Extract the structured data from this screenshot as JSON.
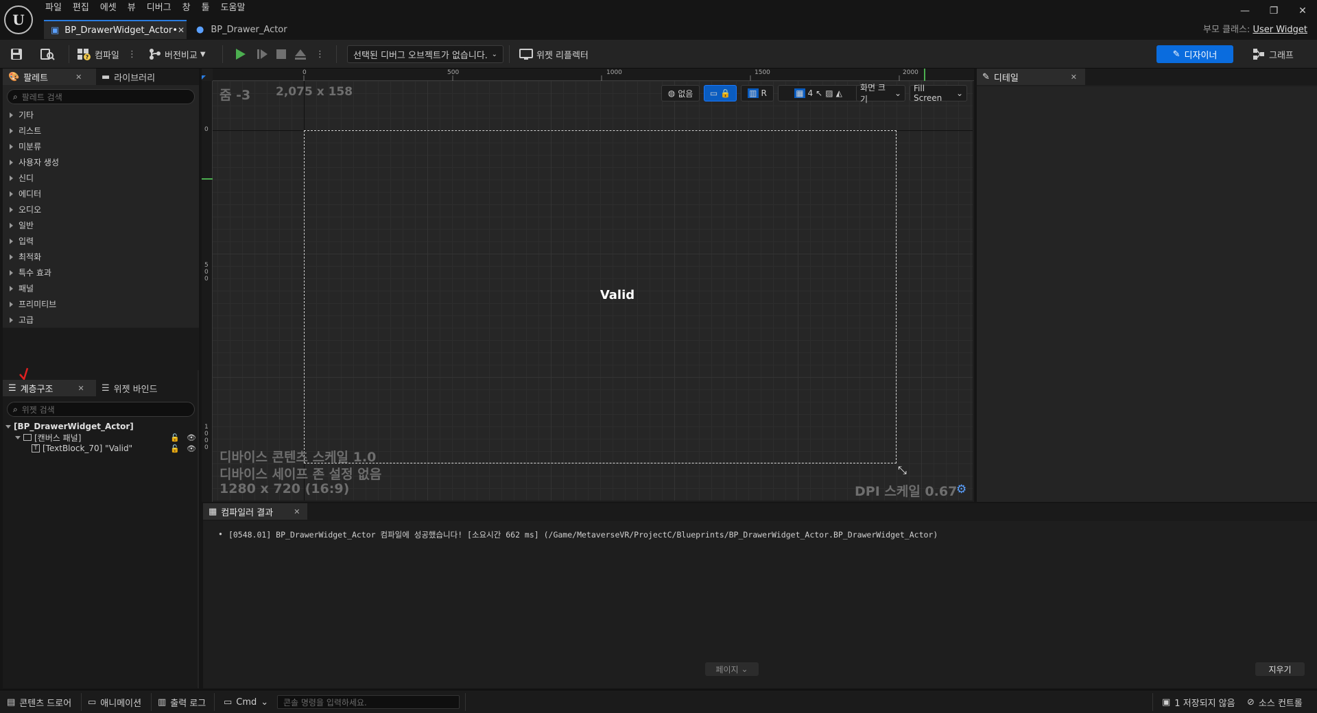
{
  "menu": [
    "파일",
    "편집",
    "에셋",
    "뷰",
    "디버그",
    "창",
    "툴",
    "도움말"
  ],
  "tabs": {
    "widget": "BP_DrawerWidget_Actor•",
    "actor": "BP_Drawer_Actor"
  },
  "parent_class": {
    "label": "부모 클래스:",
    "value": "User Widget"
  },
  "toolbar": {
    "compile": "컴파일",
    "diff": "버전비교",
    "debug_object": "선택된 디버그 오브젝트가 없습니다.",
    "widget_reflector": "위젯 리플렉터",
    "designer": "디자이너",
    "graph": "그래프"
  },
  "palette": {
    "tab": "팔레트",
    "library_tab": "라이브러리",
    "search_placeholder": "팔레트 검색",
    "categories": [
      "기타",
      "리스트",
      "미분류",
      "사용자 생성",
      "신디",
      "에디터",
      "오디오",
      "일반",
      "입력",
      "최적화",
      "특수 효과",
      "패널",
      "프리미티브",
      "고급"
    ]
  },
  "hierarchy": {
    "tab": "계층구조",
    "binding_tab": "위젯 바인드",
    "search_placeholder": "위젯 검색",
    "root": "[BP_DrawerWidget_Actor]",
    "canvas": "[캔버스 패널]",
    "textblock": "[TextBlock_70] \"Valid\""
  },
  "viewport": {
    "zoom": "줌 -3",
    "size": "2,075 x 158",
    "ruler_top": [
      "0",
      "500",
      "1000",
      "1500",
      "2000"
    ],
    "ruler_left": [
      "0",
      "5",
      "0",
      "0",
      "1",
      "0",
      "0",
      "0"
    ],
    "none_label": "없음",
    "r_label": "R",
    "grid_value": "4",
    "screen_size": "화면 크기",
    "fill_mode": "Fill Screen",
    "content_text": "Valid",
    "scale_info": "디바이스 콘텐츠 스케일 1.0",
    "safe_zone": "디바이스 세이프 존 설정 없음",
    "resolution": "1280 x 720 (16:9)",
    "dpi": "DPI 스케일 0.67"
  },
  "details": {
    "tab": "디테일"
  },
  "compiler": {
    "tab": "컴파일러 결과",
    "message": "[0548.01] BP_DrawerWidget_Actor 컴파일에 성공했습니다! [소요시간 662 ms] (/Game/MetaverseVR/ProjectC/Blueprints/BP_DrawerWidget_Actor.BP_DrawerWidget_Actor)",
    "page": "페이지",
    "clear": "지우기"
  },
  "statusbar": {
    "content_drawer": "콘텐츠 드로어",
    "animation": "애니메이션",
    "output_log": "출력 로그",
    "cmd": "Cmd",
    "cmd_placeholder": "콘솔 명령을 입력하세요.",
    "unsaved": "1 저장되지 않음",
    "source_control": "소스 컨트롤"
  },
  "colors": {
    "accent": "#0a6cde",
    "play": "#4caf50"
  }
}
